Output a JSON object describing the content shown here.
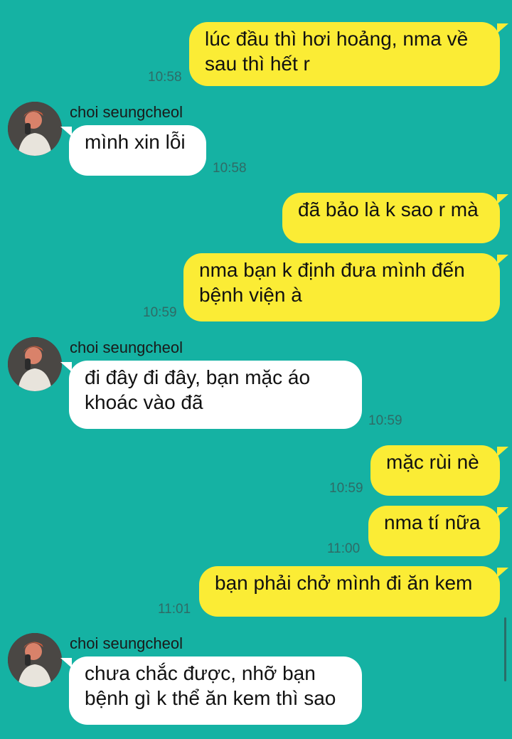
{
  "contact": {
    "name": "choi seungcheol",
    "avatar_icon": "profile-photo-avatar"
  },
  "colors": {
    "background": "#15b2a3",
    "my_bubble": "#fbec35",
    "their_bubble": "#ffffff"
  },
  "messages": [
    {
      "from": "me",
      "text": "lúc đầu thì hơi hoảng, nma về\nsau thì hết r",
      "time": "10:58"
    },
    {
      "from": "other",
      "sender": "choi seungcheol",
      "text": "mình xin lỗi",
      "time": "10:58"
    },
    {
      "from": "me",
      "text": "đã bảo là k sao r mà",
      "time": ""
    },
    {
      "from": "me",
      "text": "nma bạn k định đưa mình đến\nbệnh viện à",
      "time": "10:59"
    },
    {
      "from": "other",
      "sender": "choi seungcheol",
      "text": "đi đây đi đây, bạn mặc áo\nkhoác vào đã",
      "time": "10:59"
    },
    {
      "from": "me",
      "text": "mặc rùi nè",
      "time": "10:59"
    },
    {
      "from": "me",
      "text": "nma tí nữa",
      "time": "11:00"
    },
    {
      "from": "me",
      "text": "bạn phải chở mình đi ăn kem",
      "time": "11:01"
    },
    {
      "from": "other",
      "sender": "choi seungcheol",
      "text": "chưa chắc được, nhỡ bạn\nbệnh gì k thể ăn kem thì sao",
      "time": ""
    }
  ]
}
